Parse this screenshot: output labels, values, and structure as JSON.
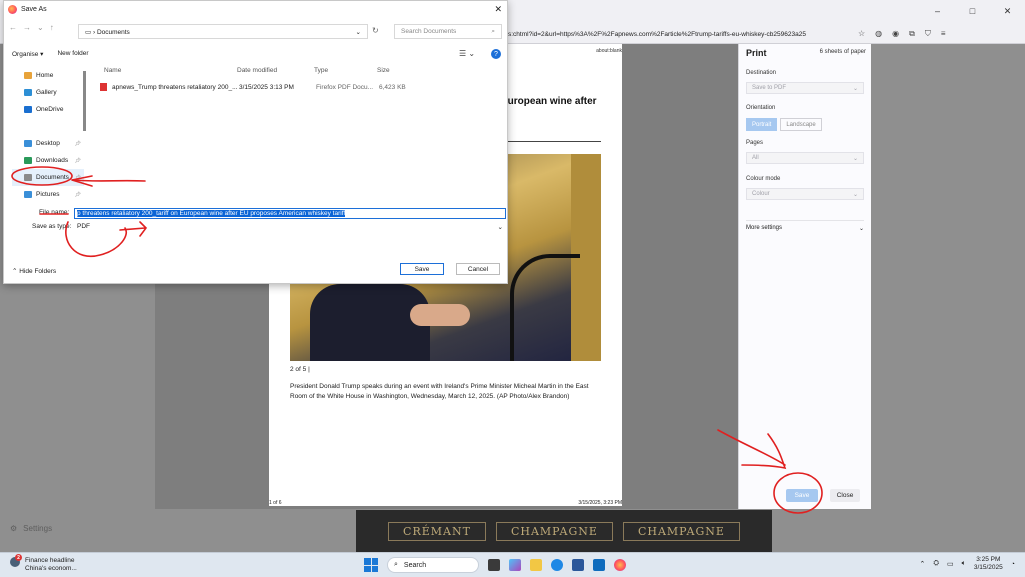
{
  "browser": {
    "url": "s:chtml?id=2&url=https%3A%2F%2Fapnews.com%2Farticle%2Ftrump-tariffs-eu-whiskey-cb259623a25",
    "window_controls": [
      "–",
      "□",
      "✕"
    ],
    "settings_label": "Settings"
  },
  "print_preview": {
    "top_url": "about:blank",
    "headline": "European wine after",
    "caption_num": "2 of 5 |",
    "caption": "President Donald Trump speaks during an event with Ireland's Prime Minister Micheal Martin in the East Room of the White House in Washington, Wednesday, March 12, 2025. (AP Photo/Alex Brandon)",
    "footer_left": "1 of 6",
    "footer_right": "3/15/2025, 3:23 PM",
    "bottom_labels": [
      "CRÉMANT",
      "CHAMPAGNE",
      "CHAMPAGNE"
    ]
  },
  "print_panel": {
    "title": "Print",
    "sheets": "6 sheets of paper",
    "destination_label": "Destination",
    "destination_value": "Save to PDF",
    "orientation_label": "Orientation",
    "portrait": "Portrait",
    "landscape": "Landscape",
    "pages_label": "Pages",
    "pages_value": "All",
    "color_label": "Colour mode",
    "color_value": "Colour",
    "more_settings": "More settings",
    "save": "Save",
    "close": "Close"
  },
  "dialog": {
    "title": "Save As",
    "path": "Documents",
    "search_placeholder": "Search Documents",
    "organise": "Organise ▾",
    "new_folder": "New folder",
    "sidebar": [
      {
        "label": "Home",
        "color": "#e8a33a"
      },
      {
        "label": "Gallery",
        "color": "#2d8fd5"
      },
      {
        "label": "OneDrive",
        "color": "#1a6fd0"
      },
      {
        "label": "Desktop",
        "color": "#3a8fd8"
      },
      {
        "label": "Downloads",
        "color": "#2a9a5a"
      },
      {
        "label": "Documents",
        "color": "#8a8a8a"
      },
      {
        "label": "Pictures",
        "color": "#3a8fd8"
      }
    ],
    "columns": [
      "Name",
      "Date modified",
      "Type",
      "Size"
    ],
    "file": {
      "name": "apnews_Trump threatens retaliatory 200_...",
      "date": "3/15/2025 3:13 PM",
      "type": "Firefox PDF Docu...",
      "size": "6,423 KB"
    },
    "file_name_label": "File name:",
    "file_name_value": "p threatens retaliatory 200_tariff on European wine after EU proposes American whiskey tariff",
    "save_type_label": "Save as type:",
    "save_type_value": "PDF",
    "hide_folders": "Hide Folders",
    "save": "Save",
    "cancel": "Cancel"
  },
  "taskbar": {
    "news_title": "Finance headline",
    "news_sub": "China's econom...",
    "news_badge": "2",
    "search": "Search",
    "time": "3:25 PM",
    "date": "3/15/2025"
  }
}
